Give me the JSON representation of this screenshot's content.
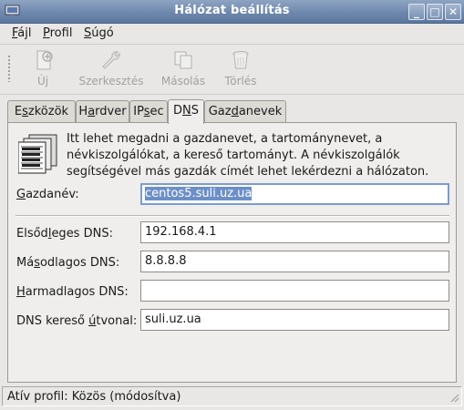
{
  "window": {
    "title": "Hálózat beállítás",
    "controls": {
      "minimize": "_",
      "maximize": "□",
      "close": "✕"
    }
  },
  "menubar": [
    {
      "pre": "",
      "key": "F",
      "post": "ájl"
    },
    {
      "pre": "",
      "key": "P",
      "post": "rofil"
    },
    {
      "pre": "",
      "key": "S",
      "post": "úgó"
    }
  ],
  "toolbar": {
    "new_label": "Új",
    "edit_label": "Szerkesztés",
    "copy_label": "Másolás",
    "delete_label": "Törlés",
    "enabled": false
  },
  "tabs": [
    {
      "pre": "E",
      "key": "s",
      "post": "zközök",
      "active": false
    },
    {
      "pre": "H",
      "key": "a",
      "post": "rdver",
      "active": false
    },
    {
      "pre": "IP",
      "key": "s",
      "post": "ec",
      "active": false
    },
    {
      "pre": "D",
      "key": "N",
      "post": "S",
      "active": true
    },
    {
      "pre": "Gaz",
      "key": "d",
      "post": "anevek",
      "active": false
    }
  ],
  "dns_panel": {
    "description": "Itt lehet megadni a gazdanevet, a tartománynevet, a névkiszolgálókat, a kereső tartományt. A névkiszolgálók segítségével más gazdák címét lehet lekérdezni a hálózaton.",
    "hostname": {
      "pre": "",
      "key": "G",
      "post": "azdanév:",
      "value": "centos5.suli.uz.ua",
      "selected": true
    },
    "primary_dns": {
      "pre": "Elsőd",
      "key": "l",
      "post": "eges DNS:",
      "value": "192.168.4.1"
    },
    "secondary_dns": {
      "pre": "Má",
      "key": "s",
      "post": "odlagos DNS:",
      "value": "8.8.8.8"
    },
    "tertiary_dns": {
      "pre": "",
      "key": "H",
      "post": "armadlagos DNS:",
      "value": ""
    },
    "search_path": {
      "pre": "DNS kereső ",
      "key": "ú",
      "post": "tvonal:",
      "value": "suli.uz.ua"
    }
  },
  "statusbar": {
    "text": "Atív profil: Közös (módosítva)"
  }
}
